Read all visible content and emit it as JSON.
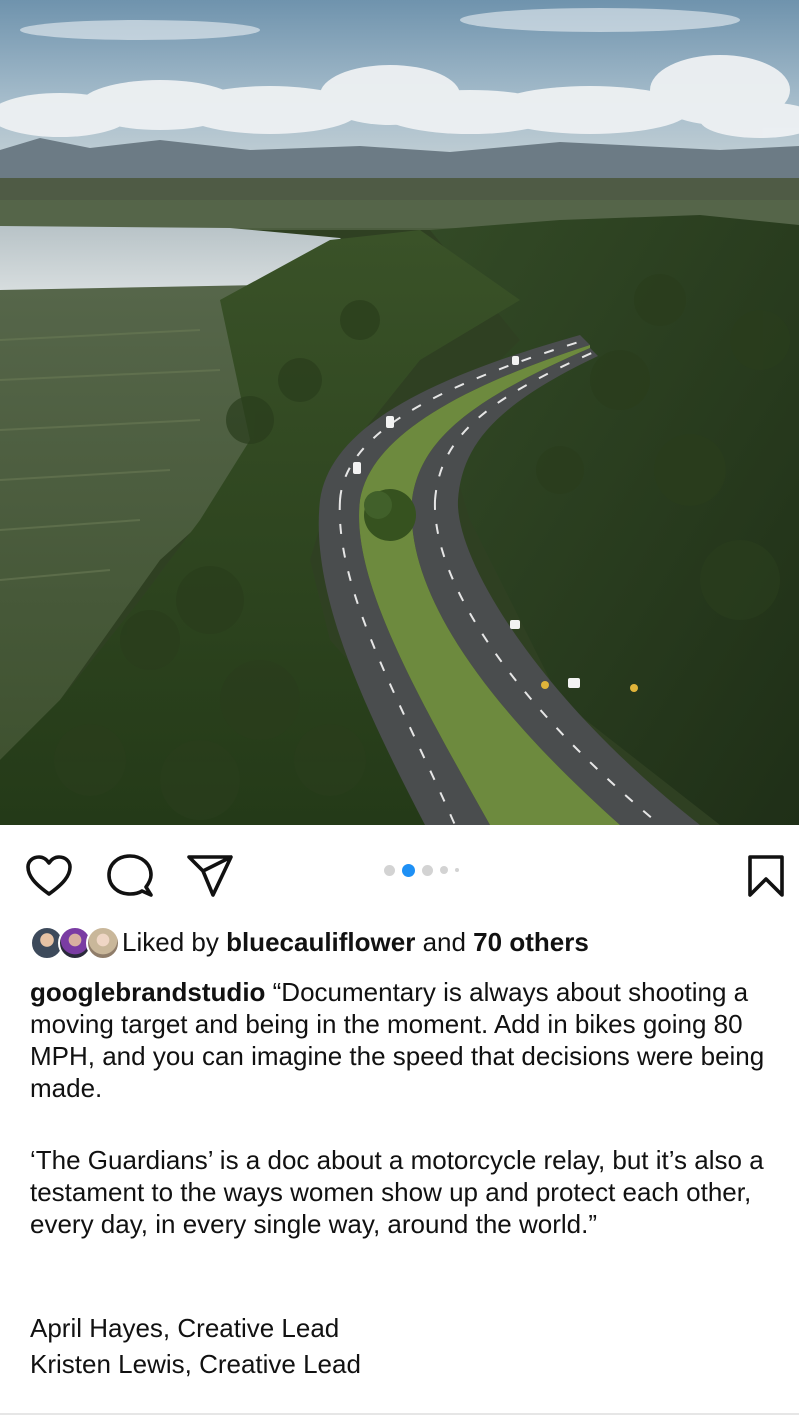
{
  "post": {
    "photo_alt": "Aerial view of a winding highway through green hills beside a lake",
    "carousel": {
      "count": 5,
      "active_index": 1
    },
    "actions": {
      "like_icon": "heart-icon",
      "comment_icon": "comment-icon",
      "share_icon": "send-icon",
      "save_icon": "bookmark-icon"
    },
    "likes": {
      "prefix": "Liked by ",
      "user": "bluecauliflower",
      "joiner": " and ",
      "others": "70 others"
    },
    "caption": {
      "username": "googlebrandstudio",
      "paragraph1": " “Documentary is always about shooting a moving target and being in the moment. Add in bikes going 80 MPH, and you can imagine the speed that decisions were being made.",
      "paragraph2": "‘The Guardians’ is a doc about a motorcycle relay, but it’s also a testament to the ways women show up and protect each other, every day, in every single way, around the world.”",
      "credit1": "April Hayes, Creative Lead",
      "credit2": "Kristen Lewis, Creative Lead"
    },
    "colors": {
      "accent": "#1e90f5",
      "inactive_dot": "#d3d3d3"
    }
  }
}
